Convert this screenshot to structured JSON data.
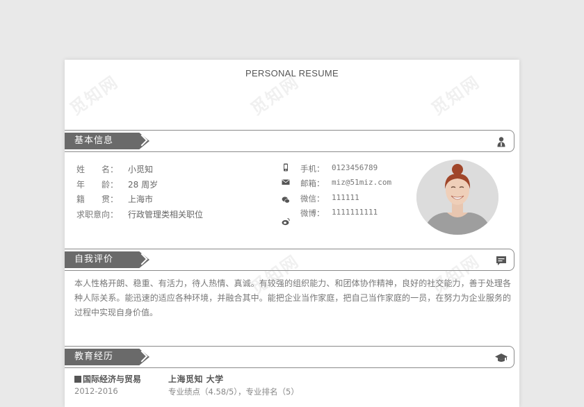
{
  "header": {
    "title": "PERSONAL RESUME"
  },
  "watermark": "觅知网",
  "sections": {
    "basic": {
      "label": "基本信息",
      "icon": "person-icon"
    },
    "self_eval": {
      "label": "自我评价",
      "icon": "chat-icon"
    },
    "education": {
      "label": "教育经历",
      "icon": "graduation-cap-icon"
    }
  },
  "basic_info": [
    {
      "label": "姓　　名：",
      "value": "小觅知"
    },
    {
      "label": "年　　龄：",
      "value": "28 周岁"
    },
    {
      "label": "籍　　贯：",
      "value": "上海市"
    },
    {
      "label": "求职意向：",
      "value": "行政管理类相关职位"
    }
  ],
  "contacts": [
    {
      "icon": "phone-icon",
      "label": "手机：",
      "value": "0123456789"
    },
    {
      "icon": "mail-icon",
      "label": "邮箱：",
      "value": "miz@51miz.com"
    },
    {
      "icon": "wechat-icon",
      "label": "微信：",
      "value": "111111"
    },
    {
      "icon": "weibo-icon",
      "label": "微博：",
      "value": "1111111111"
    }
  ],
  "self_evaluation": "本人性格开朗、稳重、有活力，待人热情、真诚。有较强的组织能力、和团体协作精神，良好的社交能力，善于处理各种人际关系。能迅速的适应各种环境，并融合其中。能把企业当作家庭，把自己当作家庭的一员，在努力为企业服务的过程中实现自身价值。",
  "education": {
    "major": "国际经济与贸易",
    "years": "2012-2016",
    "school": "上海觅知 大学",
    "gpa": "专业绩点（4.58/5），专业排名（5）"
  },
  "colors": {
    "tab": "#6a6a6a",
    "border": "#8a8a8a",
    "page": "#ffffff",
    "background": "#e9e9e9"
  }
}
